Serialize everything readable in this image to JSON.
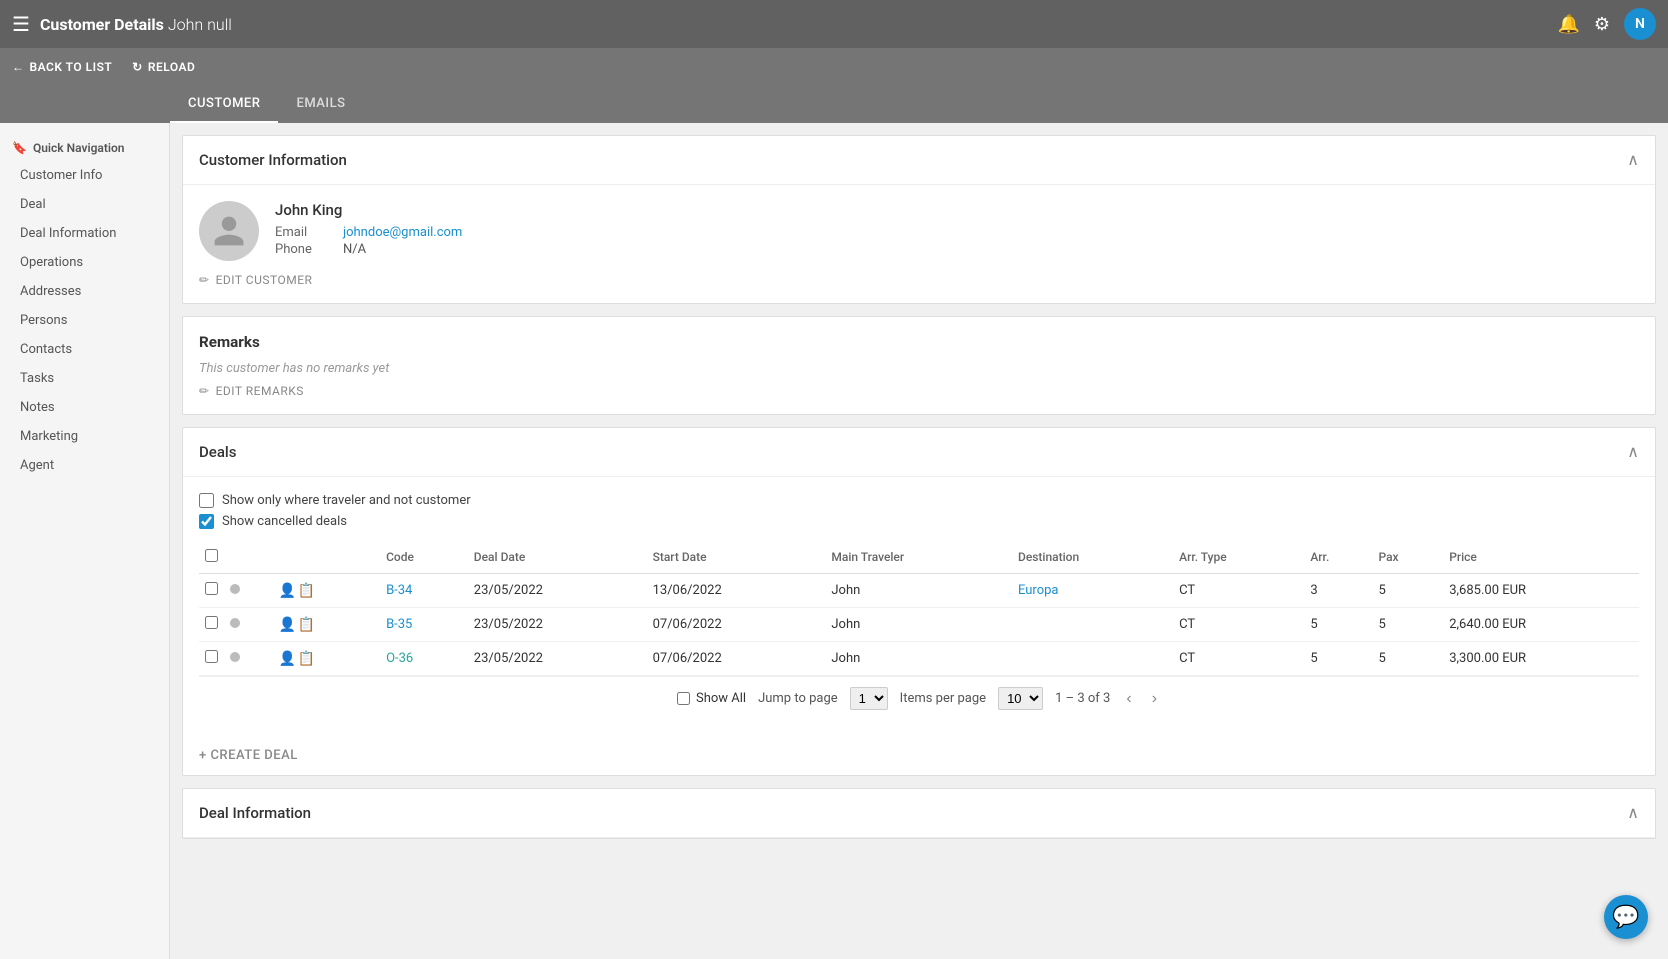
{
  "topbar": {
    "menu_icon": "☰",
    "app_name": "Customer Details",
    "customer_name": "John null",
    "bell_icon": "🔔",
    "settings_icon": "⚙",
    "avatar_letter": "N"
  },
  "subbar": {
    "back_label": "BACK TO LIST",
    "reload_label": "RELOAD"
  },
  "tabs": [
    {
      "label": "CUSTOMER",
      "active": true
    },
    {
      "label": "EMAILS",
      "active": false
    }
  ],
  "sidebar": {
    "section_label": "Quick Navigation",
    "items": [
      "Customer Info",
      "Deal",
      "Deal Information",
      "Operations",
      "Addresses",
      "Persons",
      "Contacts",
      "Tasks",
      "Notes",
      "Marketing",
      "Agent"
    ]
  },
  "customer_info": {
    "section_title": "Customer Information",
    "name": "John King",
    "email_label": "Email",
    "email_value": "johndoe@gmail.com",
    "phone_label": "Phone",
    "phone_value": "N/A",
    "edit_label": "EDIT CUSTOMER"
  },
  "remarks": {
    "section_title": "Remarks",
    "empty_text": "This customer has no remarks yet",
    "edit_label": "EDIT REMARKS"
  },
  "deals": {
    "section_title": "Deals",
    "filter1_label": "Show only where traveler and not customer",
    "filter1_checked": false,
    "filter2_label": "Show cancelled deals",
    "filter2_checked": true,
    "table_headers": [
      "",
      "",
      "",
      "Code",
      "Deal Date",
      "Start Date",
      "Main Traveler",
      "Destination",
      "Arr. Type",
      "Arr.",
      "Pax",
      "Price"
    ],
    "rows": [
      {
        "code": "B-34",
        "code_color": "blue",
        "deal_date": "23/05/2022",
        "start_date": "13/06/2022",
        "main_traveler": "John",
        "destination": "Europa",
        "destination_colored": true,
        "arr_type": "CT",
        "arr": "3",
        "pax": "5",
        "price": "3,685.00 EUR"
      },
      {
        "code": "B-35",
        "code_color": "blue",
        "deal_date": "23/05/2022",
        "start_date": "07/06/2022",
        "main_traveler": "John",
        "destination": "",
        "destination_colored": false,
        "arr_type": "CT",
        "arr": "5",
        "pax": "5",
        "price": "2,640.00 EUR"
      },
      {
        "code": "O-36",
        "code_color": "teal",
        "deal_date": "23/05/2022",
        "start_date": "07/06/2022",
        "main_traveler": "John",
        "destination": "",
        "destination_colored": false,
        "arr_type": "CT",
        "arr": "5",
        "pax": "5",
        "price": "3,300.00 EUR"
      }
    ],
    "pagination": {
      "show_all_label": "Show All",
      "jump_label": "Jump to page",
      "current_page": "1",
      "items_per_page_label": "Items per page",
      "items_per_page": "10",
      "page_info": "1 – 3 of 3"
    },
    "create_label": "+ CREATE DEAL"
  },
  "deal_info_section": {
    "section_title": "Deal Information"
  },
  "colors": {
    "accent": "#1a8fd1",
    "header_bg": "#616161",
    "subheader_bg": "#757575"
  }
}
